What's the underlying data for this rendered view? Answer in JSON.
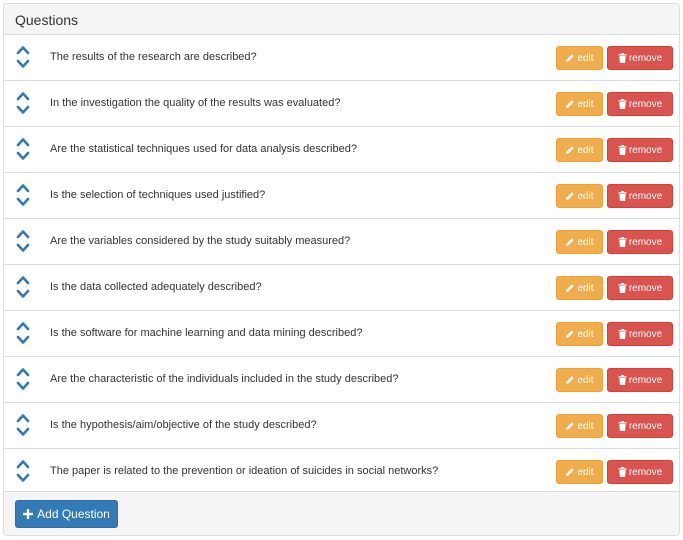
{
  "panel": {
    "title": "Questions"
  },
  "questions": [
    {
      "text": "The results of the research are described?"
    },
    {
      "text": "In the investigation the quality of the results was evaluated?"
    },
    {
      "text": "Are the statistical techniques used for data analysis described?"
    },
    {
      "text": "Is the selection of techniques used justified?"
    },
    {
      "text": "Are the variables considered by the study suitably measured?"
    },
    {
      "text": "Is the data collected adequately described?"
    },
    {
      "text": "Is the software for machine learning and data mining described?"
    },
    {
      "text": "Are the characteristic of the individuals included in the study described?"
    },
    {
      "text": "Is the hypothesis/aim/objective of the study described?"
    },
    {
      "text": "The paper is related to the prevention or ideation of suicides in social networks?"
    }
  ],
  "actions": {
    "edit_label": "edit",
    "remove_label": "remove",
    "edit_icon": "pencil-icon",
    "remove_icon": "trash-icon",
    "move_up_icon": "chevron-up-icon",
    "move_down_icon": "chevron-down-icon"
  },
  "footer": {
    "add_label": "Add Question",
    "add_icon": "plus-icon"
  },
  "colors": {
    "edit": "#f0ad4e",
    "remove": "#d9534f",
    "primary": "#337ab7",
    "arrow": "#337ab7"
  }
}
